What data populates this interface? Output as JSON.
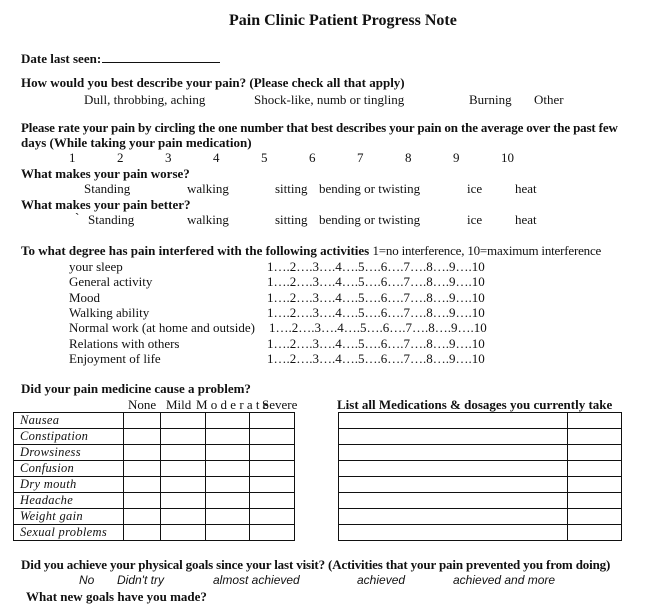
{
  "title": "Pain Clinic Patient Progress Note",
  "date_last_seen": {
    "label": "Date last seen:",
    "value": ""
  },
  "describe_pain": {
    "question": "How would you best describe your pain? (Please check all that apply)",
    "options": [
      "Dull, throbbing, aching",
      "Shock-like, numb or tingling",
      "Burning",
      "Other"
    ]
  },
  "rate_pain": {
    "question_line1": "Please rate your pain by circling the one number that best describes your pain on the average over the past few",
    "question_line2": "days (While taking your pain medication)",
    "scale": [
      "1",
      "2",
      "3",
      "4",
      "5",
      "6",
      "7",
      "8",
      "9",
      "10"
    ]
  },
  "pain_worse": {
    "question": "What makes your pain worse?",
    "options": [
      "Standing",
      "walking",
      "sitting",
      "bending or twisting",
      "ice",
      "heat"
    ]
  },
  "pain_better": {
    "question": "What makes your pain better?",
    "marker": "`",
    "options": [
      "Standing",
      "walking",
      "sitting",
      "bending or twisting",
      "ice",
      "heat"
    ]
  },
  "interference": {
    "question": "To what degree has pain interfered with the following activities",
    "legend": "1=no interference, 10=maximum interference",
    "scale_text": "1….2….3….4….5….6….7….8….9….10",
    "activities": [
      "your sleep",
      "General activity",
      "Mood",
      "Walking ability",
      "Normal work (at home and outside)",
      "Relations with others",
      "Enjoyment of life"
    ]
  },
  "side_effects": {
    "question": "Did your pain medicine cause a problem?",
    "columns": [
      "None",
      "Mild",
      "M o d e r a t e",
      "Severe"
    ],
    "rows": [
      "Nausea",
      "Constipation",
      "Drowsiness",
      "Confusion",
      "Dry mouth",
      "Headache",
      "Weight gain",
      "Sexual problems"
    ]
  },
  "medications": {
    "heading": "List all Medications & dosages you currently take",
    "row_count": 8
  },
  "physical_goals": {
    "question": "Did you achieve your physical goals since your last visit? (Activities that your pain prevented you from doing)",
    "options": [
      "No",
      "Didn't try",
      "almost achieved",
      "achieved",
      "achieved and more"
    ]
  },
  "new_goals": {
    "question": "What new goals have you made?"
  }
}
